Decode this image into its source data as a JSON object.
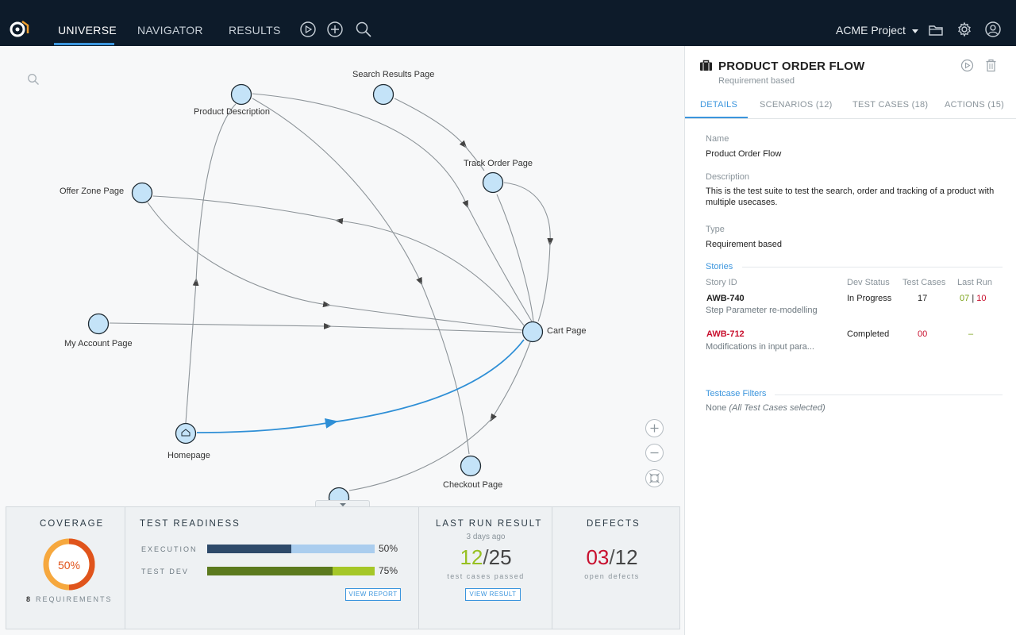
{
  "nav": {
    "tabs": [
      "UNIVERSE",
      "NAVIGATOR",
      "RESULTS"
    ],
    "project": "ACME Project",
    "accent": "#3b95dd"
  },
  "graph": {
    "nodes": {
      "product_description": "Product Description",
      "search_results": "Search Results Page",
      "track_order": "Track Order Page",
      "offer_zone": "Offer Zone Page",
      "my_account": "My Account Page",
      "cart": "Cart Page",
      "homepage": "Homepage",
      "checkout": "Checkout Page"
    }
  },
  "dashboard": {
    "coverage": {
      "title": "COVERAGE",
      "percent_label": "50%",
      "percent": 50,
      "req_count": "8",
      "req_label": "REQUIREMENTS"
    },
    "readiness": {
      "title": "TEST READINESS",
      "execution_label": "EXECUTION",
      "execution_pct": "50%",
      "execution_value": 0.5,
      "testdev_label": "TEST DEV",
      "testdev_pct": "75%",
      "testdev_value": 0.75,
      "button": "VIEW REPORT"
    },
    "last_run": {
      "title": "LAST RUN RESULT",
      "when": "3 days ago",
      "passed": "12",
      "total": "25",
      "caption": "test cases passed",
      "button": "VIEW RESULT"
    },
    "defects": {
      "title": "DEFECTS",
      "open": "03",
      "total": "12",
      "caption": "open defects"
    }
  },
  "panel": {
    "title": "PRODUCT ORDER FLOW",
    "subtitle": "Requirement based",
    "tabs": [
      "DETAILS",
      "SCENARIOS (12)",
      "TEST CASES (18)",
      "ACTIONS (15)"
    ],
    "name_label": "Name",
    "name_value": "Product Order Flow",
    "desc_label": "Description",
    "desc_value": "This is the test suite to test the search, order and tracking of a product with multiple usecases.",
    "type_label": "Type",
    "type_value": "Requirement based",
    "stories": {
      "heading": "Stories",
      "columns": [
        "Story ID",
        "Dev Status",
        "Test Cases",
        "Last Run"
      ],
      "rows": [
        {
          "id": "AWB-740",
          "desc": "Step Parameter re-modelling",
          "status": "In Progress",
          "cases": "17",
          "run_pass": "07",
          "run_sep": "|",
          "run_fail": "10"
        },
        {
          "id": "AWB-712",
          "desc": "Modifications in input para...",
          "status": "Completed",
          "cases": "00",
          "run": "–"
        }
      ]
    },
    "filters": {
      "heading": "Testcase Filters",
      "value_prefix": "None",
      "value_note": "(All Test Cases selected)"
    }
  }
}
